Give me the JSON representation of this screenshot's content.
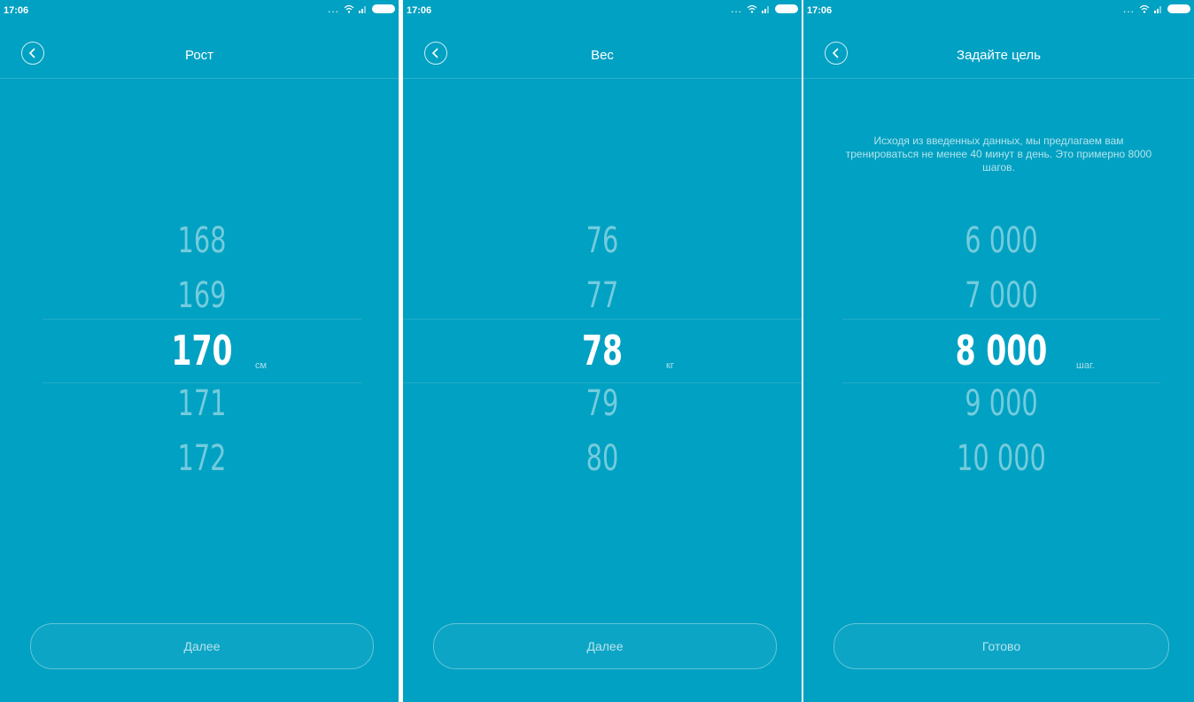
{
  "status": {
    "time": "17:06",
    "dots": "..."
  },
  "screens": [
    {
      "title": "Рост",
      "items": [
        "168",
        "169",
        "170",
        "171",
        "172"
      ],
      "unit": "см",
      "button": "Далее"
    },
    {
      "title": "Вес",
      "items": [
        "76",
        "77",
        "78",
        "79",
        "80"
      ],
      "unit": "кг",
      "button": "Далее"
    },
    {
      "title": "Задайте цель",
      "description": "Исходя из введенных данных, мы предлагаем вам тренироваться не менее 40 минут в день. Это примерно 8000 шагов.",
      "items": [
        "6 000",
        "7 000",
        "8 000",
        "9 000",
        "10 000"
      ],
      "unit": "шаг.",
      "button": "Готово"
    }
  ],
  "colors": {
    "background": "#00a1c2",
    "text": "#ffffff"
  },
  "icons": {
    "back": "chevron-left-icon",
    "wifi": "wifi-icon",
    "signal": "signal-icon",
    "battery": "battery-icon"
  }
}
